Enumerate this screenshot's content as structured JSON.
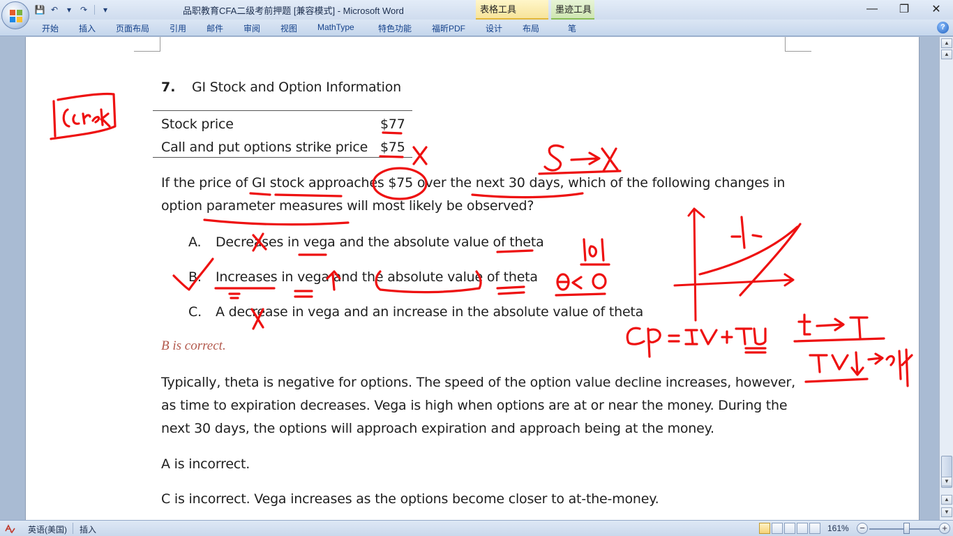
{
  "window": {
    "title": "品职教育CFA二级考前押题 [兼容模式] - Microsoft Word",
    "contextual_tabs": {
      "table_tools": "表格工具",
      "ink_tools": "墨迹工具"
    },
    "controls": {
      "minimize": "—",
      "restore": "❐",
      "close": "✕"
    }
  },
  "quick_access": {
    "save": "💾",
    "undo": "↶",
    "undo_menu": "▾",
    "redo": "↷",
    "customize": "▾"
  },
  "ribbon": {
    "tabs": [
      "开始",
      "插入",
      "页面布局",
      "引用",
      "邮件",
      "审阅",
      "视图",
      "MathType",
      "特色功能",
      "福昕PDF",
      "设计",
      "布局",
      "笔"
    ],
    "help": "?"
  },
  "document": {
    "question_number": "7.",
    "heading": "GI Stock and Option Information",
    "table": [
      {
        "label": "Stock price",
        "value": "$77"
      },
      {
        "label": "Call and put options strike price",
        "value": "$75"
      }
    ],
    "question": "If the price of GI stock approaches $75 over the next 30 days, which of the following changes in option parameter measures will most likely be observed?",
    "options": [
      {
        "letter": "A.",
        "text": "Decreases in vega and the absolute value of theta"
      },
      {
        "letter": "B.",
        "text": "Increases in vega and the absolute value of theta"
      },
      {
        "letter": "C.",
        "text": "A decrease in vega and an increase in the absolute value of theta"
      }
    ],
    "answer": "B is correct.",
    "explanation": "Typically, theta is negative for options. The speed of the option value decline increases, however, as time to expiration decreases. Vega is high when options are at or near the money. During the next 30 days, the options will approach expiration and approach being at the money.",
    "a_incorrect": "A is incorrect.",
    "c_incorrect": "C is incorrect. Vega increases as the options become closer to at-the-money."
  },
  "ink_color": "#ee1111",
  "status_bar": {
    "language": "英语(美国)",
    "mode": "插入",
    "zoom": "161%",
    "zoom_out": "−",
    "zoom_in": "+"
  },
  "scrollbar": {
    "up": "▲",
    "down": "▼"
  }
}
